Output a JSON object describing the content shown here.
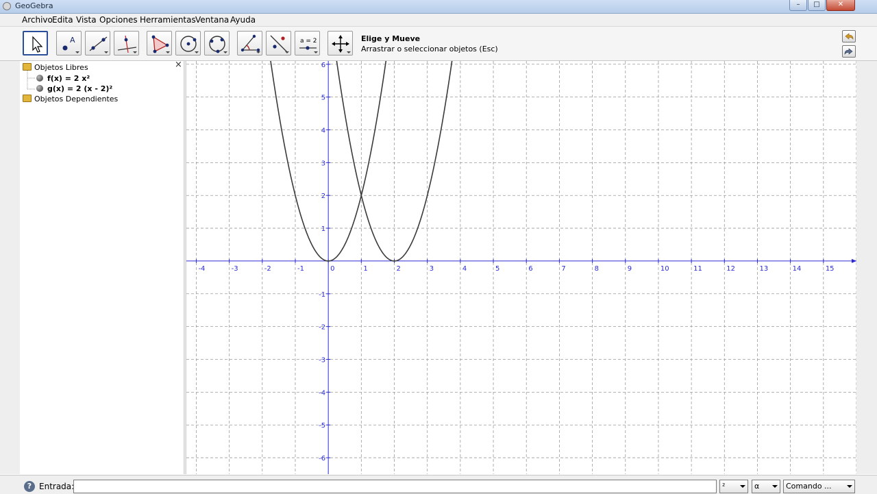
{
  "window": {
    "title": "GeoGebra",
    "buttons": {
      "minimize": "–",
      "maximize": "□",
      "close": "✕"
    }
  },
  "menu": [
    "Archivo",
    "Edita",
    "Vista",
    "Opciones",
    "Herramientas",
    "Ventana",
    "Ayuda"
  ],
  "toolbar": {
    "tools": [
      {
        "name": "move-tool",
        "active": true
      },
      {
        "name": "point-tool",
        "label": "A"
      },
      {
        "name": "line-tool"
      },
      {
        "name": "perpendicular-tool"
      },
      {
        "name": "polygon-tool"
      },
      {
        "name": "circle-tool"
      },
      {
        "name": "circle-three-points-tool"
      },
      {
        "name": "angle-tool"
      },
      {
        "name": "reflect-tool"
      },
      {
        "name": "slider-tool",
        "label": "a = 2"
      },
      {
        "name": "move-view-tool"
      }
    ],
    "active_tool_name": "Elige y Mueve",
    "active_tool_help": "Arrastrar o seleccionar objetos (Esc)"
  },
  "algebra": {
    "close_glyph": "×",
    "free_objects": "Objetos Libres",
    "functions": [
      "f(x) = 2 x²",
      "g(x) = 2 (x - 2)²"
    ],
    "dependent_objects": "Objetos Dependientes"
  },
  "graphics": {
    "axis_color": "#2a2ad0",
    "curve_color": "#3a3a3a",
    "grid_color": "#9a9a9a",
    "x_ticks": [
      "-4",
      "-3",
      "-2",
      "-1",
      "0",
      "1",
      "2",
      "3",
      "4",
      "5",
      "6",
      "7",
      "8",
      "9",
      "10",
      "11",
      "12",
      "13",
      "14",
      "15"
    ],
    "y_ticks_pos": [
      "1",
      "2",
      "3",
      "4",
      "5",
      "6"
    ],
    "y_ticks_neg": [
      "-1",
      "-2",
      "-3",
      "-4",
      "-5",
      "-6"
    ]
  },
  "chart_data": {
    "type": "line",
    "title": "",
    "xlabel": "",
    "ylabel": "",
    "xlim": [
      -4.3,
      16
    ],
    "ylim": [
      -6.5,
      6.1
    ],
    "grid": true,
    "series": [
      {
        "name": "f(x) = 2 x²",
        "formula": "2 x^2",
        "x": [
          -1.75,
          -1.5,
          -1,
          -0.5,
          0,
          0.5,
          1,
          1.5,
          1.75
        ],
        "y": [
          6.125,
          4.5,
          2,
          0.5,
          0,
          0.5,
          2,
          4.5,
          6.125
        ]
      },
      {
        "name": "g(x) = 2 (x - 2)²",
        "formula": "2 (x - 2)^2",
        "x": [
          0.25,
          0.5,
          1,
          1.5,
          2,
          2.5,
          3,
          3.5,
          3.75
        ],
        "y": [
          6.125,
          4.5,
          2,
          0.5,
          0,
          0.5,
          2,
          4.5,
          6.125
        ]
      }
    ]
  },
  "input_bar": {
    "label": "Entrada:",
    "value": "",
    "help_glyph": "?",
    "combo_symbols": "²",
    "combo_greek": "α",
    "combo_command": "Comando ..."
  }
}
